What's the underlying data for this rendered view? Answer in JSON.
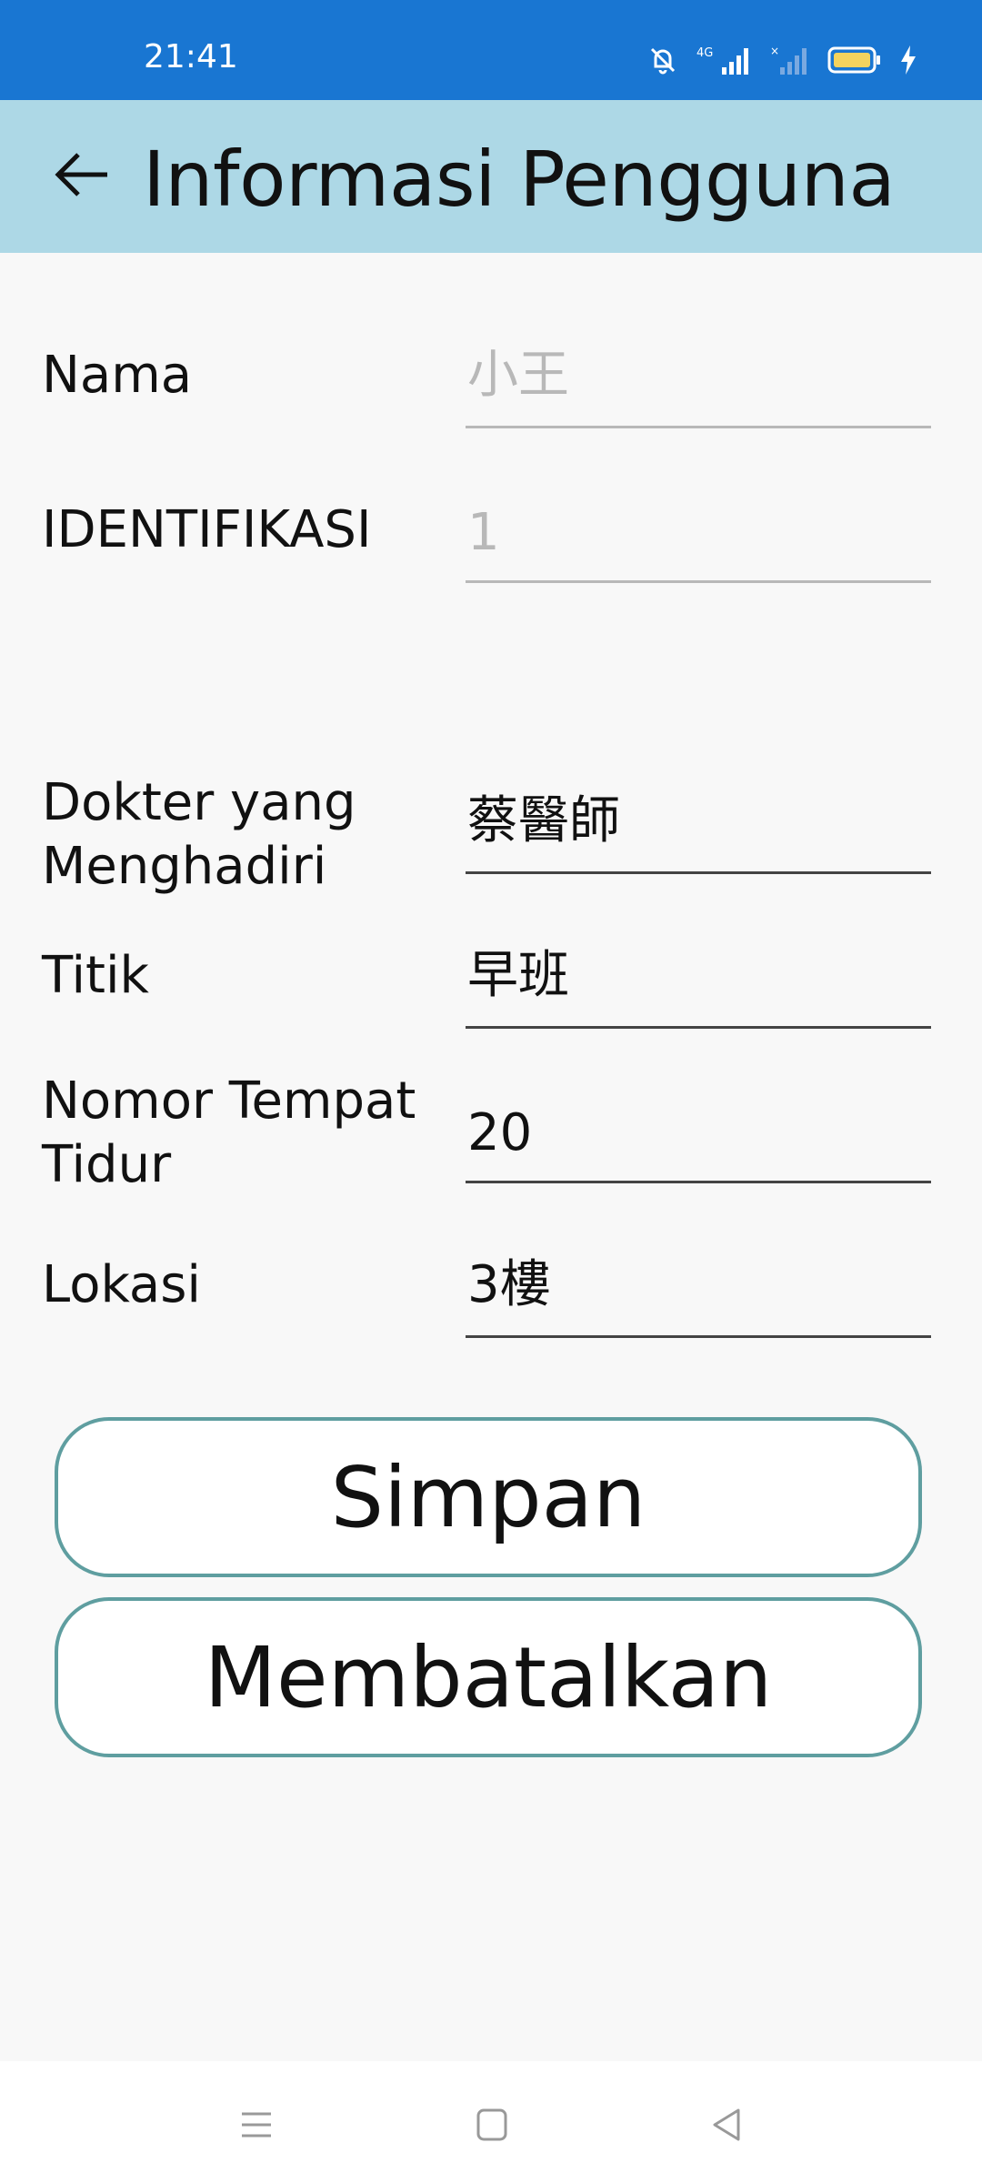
{
  "status_bar": {
    "time": "21:41",
    "network": "4G",
    "icons": [
      "mute-bell-icon",
      "signal-4g-icon",
      "signal-no-sim-icon",
      "battery-icon",
      "charging-bolt-icon"
    ],
    "battery_color": "#f4d35e",
    "bar_color": "#1976d2"
  },
  "app_bar": {
    "title": "Informasi Pengguna",
    "back_icon": "arrow-left-icon",
    "color": "#add8e6"
  },
  "form": {
    "nama": {
      "label": "Nama",
      "value": "小王"
    },
    "identifikasi": {
      "label": "IDENTIFIKASI",
      "value": "1"
    },
    "dokter": {
      "label_line1": "Dokter yang",
      "label_line2": "Menghadiri",
      "value": "蔡醫師"
    },
    "titik": {
      "label": "Titik",
      "value": "早班"
    },
    "tempat_tidur": {
      "label_line1": "Nomor Tempat",
      "label_line2": "Tidur",
      "value": "20"
    },
    "lokasi": {
      "label": "Lokasi",
      "value": "3樓"
    }
  },
  "buttons": {
    "save_label": "Simpan",
    "cancel_label": "Membatalkan",
    "border_color": "#5f9ea0"
  },
  "nav_bar": {
    "icons": [
      "menu-icon",
      "home-square-icon",
      "back-triangle-icon"
    ]
  }
}
